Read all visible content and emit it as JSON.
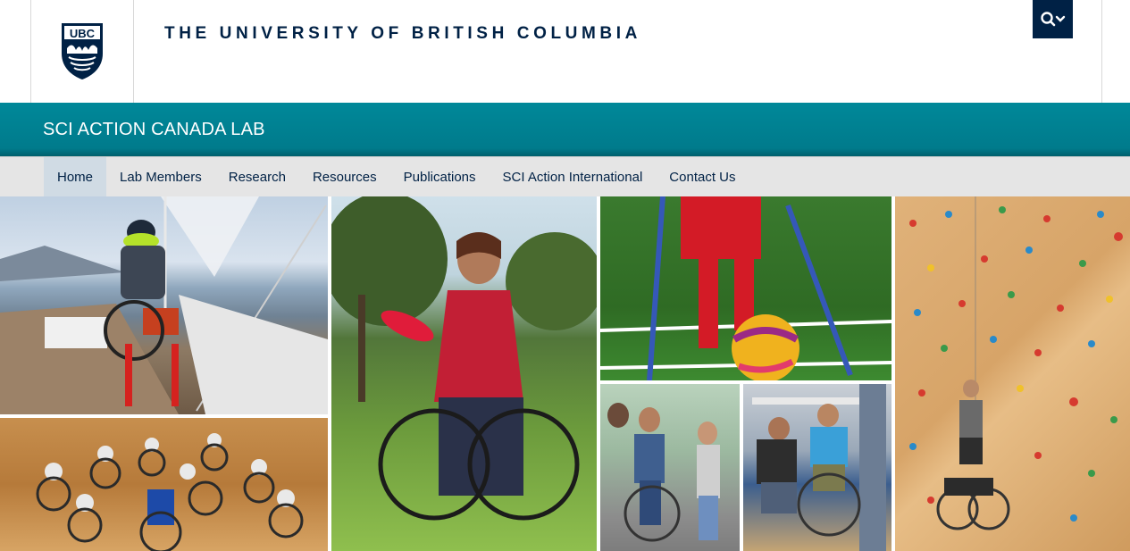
{
  "header": {
    "logo_text": "UBC",
    "wordmark": "THE UNIVERSITY OF BRITISH COLUMBIA",
    "search_icon": "search-icon"
  },
  "unit": {
    "title": "SCI ACTION CANADA LAB"
  },
  "nav": {
    "items": [
      {
        "label": "Home",
        "active": true
      },
      {
        "label": "Lab Members"
      },
      {
        "label": "Research"
      },
      {
        "label": "Resources"
      },
      {
        "label": "Publications"
      },
      {
        "label": "SCI Action International"
      },
      {
        "label": "Contact Us"
      }
    ]
  },
  "colors": {
    "ubc_blue": "#002145",
    "unit_teal": "#008899",
    "nav_bg": "#e5e5e5",
    "nav_active": "#d0dbe4"
  }
}
